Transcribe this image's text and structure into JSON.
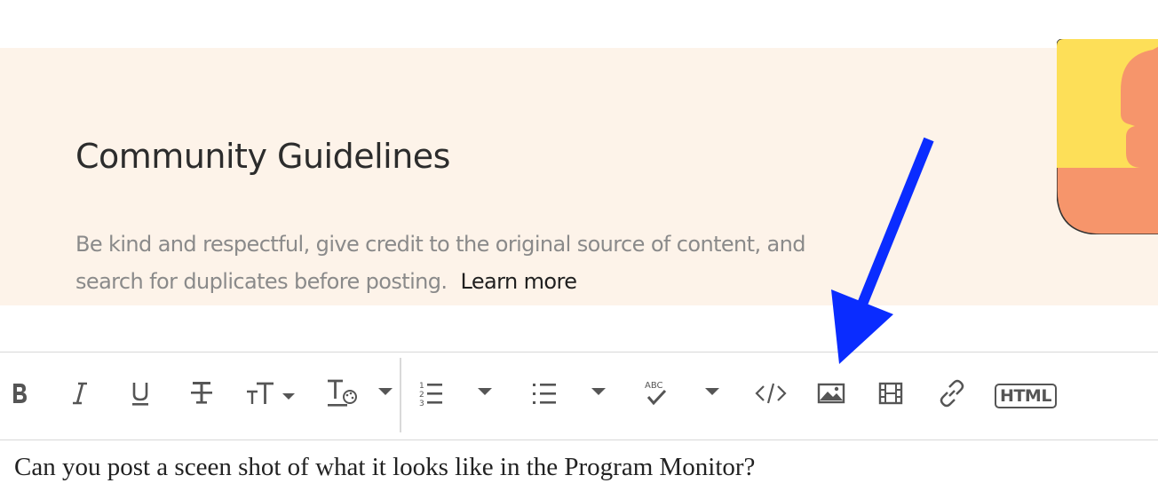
{
  "guidelines": {
    "title": "Community Guidelines",
    "description": "Be kind and respectful, give credit to the original source of content, and search for duplicates before posting.",
    "learn_more": "Learn more"
  },
  "toolbar": {
    "buttons": [
      {
        "name": "bold",
        "icon": "bold-icon"
      },
      {
        "name": "italic",
        "icon": "italic-icon"
      },
      {
        "name": "underline",
        "icon": "underline-icon"
      },
      {
        "name": "strikethrough",
        "icon": "strikethrough-icon"
      },
      {
        "name": "font-size",
        "icon": "font-size-icon"
      },
      {
        "name": "text-color",
        "icon": "text-color-icon"
      },
      {
        "name": "numbered-list",
        "icon": "numbered-list-icon"
      },
      {
        "name": "bulleted-list",
        "icon": "bulleted-list-icon"
      },
      {
        "name": "spell-check",
        "icon": "spell-check-icon"
      },
      {
        "name": "code",
        "icon": "code-icon"
      },
      {
        "name": "insert-image",
        "icon": "image-icon"
      },
      {
        "name": "insert-video",
        "icon": "film-icon"
      },
      {
        "name": "insert-link",
        "icon": "link-icon"
      }
    ],
    "html_label": "HTML"
  },
  "editor": {
    "content": "Can you post a sceen shot of what it looks like in the Program Monitor?"
  },
  "colors": {
    "banner_bg": "#fdf3e9",
    "annotation_arrow": "#0a2cff",
    "icon_color": "#555555"
  }
}
